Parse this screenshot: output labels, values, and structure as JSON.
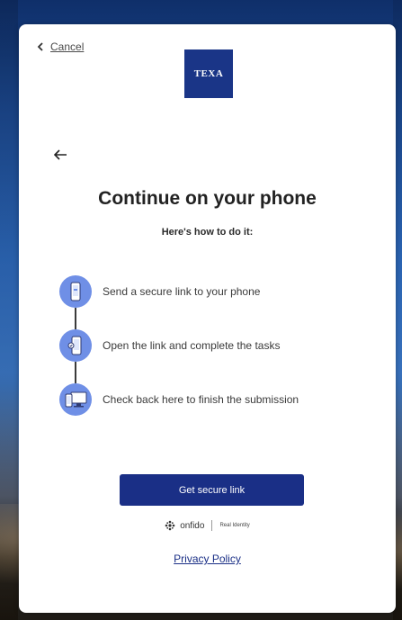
{
  "colors": {
    "brand_navy": "#1a2f86",
    "logo_blue": "#1a3587",
    "step_circle": "#6f8fe6",
    "card_bg": "#ffffff"
  },
  "header": {
    "cancel_label": "Cancel",
    "cancel_icon": "chevron-left-icon",
    "logo_text": "TEXA",
    "back_icon": "arrow-left-icon"
  },
  "main": {
    "title": "Continue on your phone",
    "subtitle": "Here's how to do it:",
    "steps": [
      {
        "label": "Send a secure link to your phone",
        "icon": "phone-link-icon"
      },
      {
        "label": "Open the link and complete the tasks",
        "icon": "phone-tasks-icon"
      },
      {
        "label": "Check back here to finish the submission",
        "icon": "phone-desktop-icon"
      }
    ],
    "cta_label": "Get secure link"
  },
  "footer": {
    "brand_name": "onfido",
    "brand_tagline": "Real Identity",
    "privacy_label": "Privacy Policy"
  }
}
